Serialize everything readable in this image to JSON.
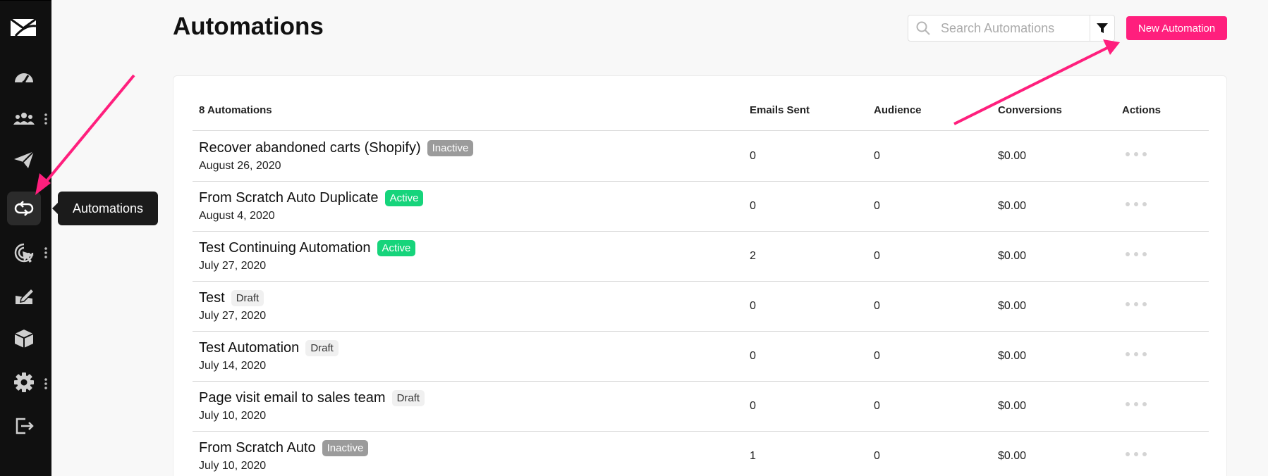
{
  "sidebar": {
    "items": [
      {
        "icon": "dashboard-gauge-icon"
      },
      {
        "icon": "contacts-group-icon",
        "has_menu": true
      },
      {
        "icon": "campaigns-send-icon"
      },
      {
        "icon": "automations-loop-icon",
        "active": true
      },
      {
        "icon": "tracking-cursor-icon",
        "has_menu": true
      },
      {
        "icon": "forms-edit-icon"
      },
      {
        "icon": "integrations-box-icon"
      },
      {
        "icon": "settings-gear-icon",
        "has_menu": true
      },
      {
        "icon": "logout-icon"
      }
    ],
    "tooltip": "Automations"
  },
  "header": {
    "title": "Automations",
    "search_placeholder": "Search Automations",
    "new_button": "New Automation"
  },
  "table": {
    "count_label": "8 Automations",
    "columns": {
      "emails_sent": "Emails Sent",
      "audience": "Audience",
      "conversions": "Conversions",
      "actions": "Actions"
    },
    "rows": [
      {
        "name": "Recover abandoned carts (Shopify)",
        "status": "Inactive",
        "date": "August 26, 2020",
        "emails_sent": "0",
        "audience": "0",
        "conversions": "$0.00"
      },
      {
        "name": "From Scratch Auto Duplicate",
        "status": "Active",
        "date": "August 4, 2020",
        "emails_sent": "0",
        "audience": "0",
        "conversions": "$0.00"
      },
      {
        "name": "Test Continuing Automation",
        "status": "Active",
        "date": "July 27, 2020",
        "emails_sent": "2",
        "audience": "0",
        "conversions": "$0.00"
      },
      {
        "name": "Test",
        "status": "Draft",
        "date": "July 27, 2020",
        "emails_sent": "0",
        "audience": "0",
        "conversions": "$0.00"
      },
      {
        "name": "Test Automation",
        "status": "Draft",
        "date": "July 14, 2020",
        "emails_sent": "0",
        "audience": "0",
        "conversions": "$0.00"
      },
      {
        "name": "Page visit email to sales team",
        "status": "Draft",
        "date": "July 10, 2020",
        "emails_sent": "0",
        "audience": "0",
        "conversions": "$0.00"
      },
      {
        "name": "From Scratch Auto",
        "status": "Inactive",
        "date": "July 10, 2020",
        "emails_sent": "1",
        "audience": "0",
        "conversions": "$0.00"
      }
    ]
  },
  "colors": {
    "accent": "#ff1f7d",
    "active": "#16d47b",
    "inactive": "#9b9b9b",
    "sidebar": "#101010"
  }
}
